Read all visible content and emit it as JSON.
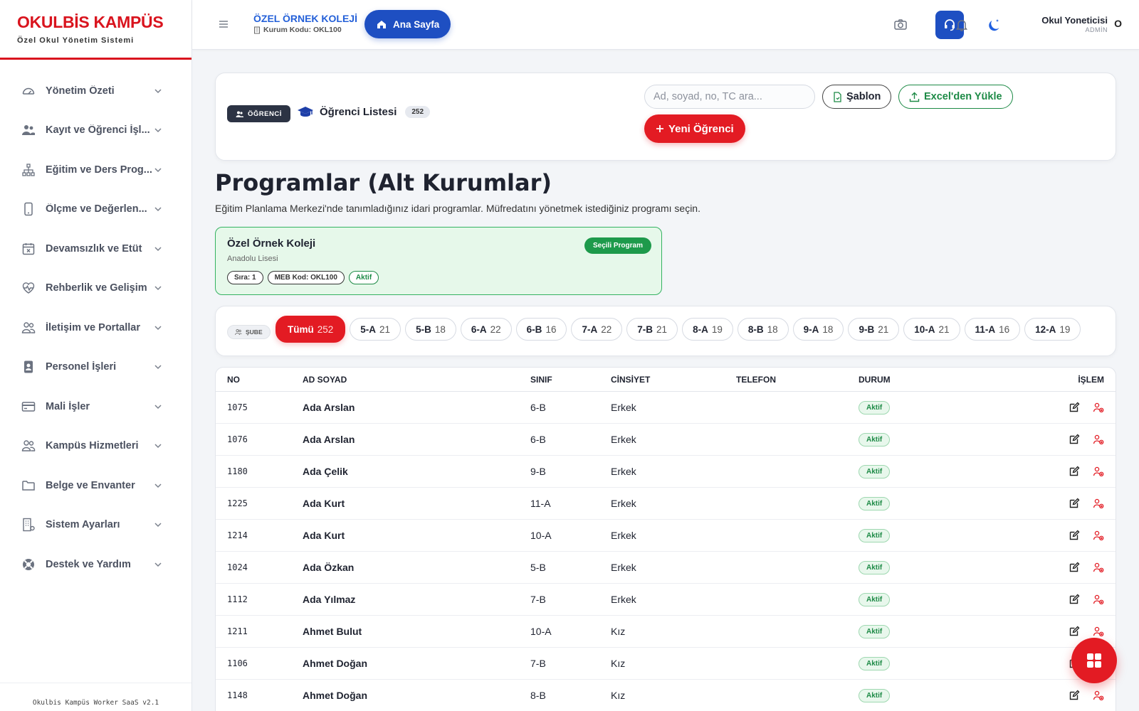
{
  "brand": {
    "title": "OKULBİS KAMPÜS",
    "subtitle": "Özel Okul Yönetim Sistemi"
  },
  "sidebar": {
    "items": [
      {
        "label": "Yönetim Özeti",
        "icon": "gauge-icon"
      },
      {
        "label": "Kayıt ve Öğrenci İşl...",
        "icon": "users-icon"
      },
      {
        "label": "Eğitim ve Ders Prog...",
        "icon": "sitemap-icon"
      },
      {
        "label": "Ölçme ve Değerlen...",
        "icon": "mobile-icon"
      },
      {
        "label": "Devamsızlık ve Etüt",
        "icon": "calendar-x-icon"
      },
      {
        "label": "Rehberlik ve Gelişim",
        "icon": "heart-pulse-icon"
      },
      {
        "label": "İletişim ve Portallar",
        "icon": "people-icon"
      },
      {
        "label": "Personel İşleri",
        "icon": "id-badge-icon"
      },
      {
        "label": "Mali İşler",
        "icon": "credit-card-icon"
      },
      {
        "label": "Kampüs Hizmetleri",
        "icon": "people-icon"
      },
      {
        "label": "Belge ve Envanter",
        "icon": "folder-icon"
      },
      {
        "label": "Sistem Ayarları",
        "icon": "building-gear-icon"
      },
      {
        "label": "Destek ve Yardım",
        "icon": "lifebuoy-icon"
      }
    ],
    "footer": "Okulbis Kampüs Worker SaaS v2.1"
  },
  "topbar": {
    "school_name": "ÖZEL ÖRNEK KOLEJİ",
    "school_code": "Kurum Kodu: OKL100",
    "home_label": "Ana Sayfa",
    "user_name": "Okul Yoneticisi",
    "user_role": "ADMİN",
    "user_initial": "O"
  },
  "header": {
    "chip": "ÖĞRENCİ",
    "list_title": "Öğrenci Listesi",
    "count": "252",
    "search_placeholder": "Ad, soyad, no, TC ara...",
    "template_label": "Şablon",
    "excel_label": "Excel'den Yükle",
    "new_label": "Yeni Öğrenci"
  },
  "page": {
    "title": "Programlar (Alt Kurumlar)",
    "description": "Eğitim Planlama Merkezi'nde tanımladığınız idari programlar. Müfredatını yönetmek istediğiniz programı seçin."
  },
  "program": {
    "name": "Özel Örnek Koleji",
    "type": "Anadolu Lisesi",
    "badge": "Seçili Program",
    "tags": [
      "Sıra: 1",
      "MEB Kod: OKL100",
      "Aktif"
    ]
  },
  "filters": {
    "label": "ŞUBE",
    "pills": [
      {
        "name": "Tümü",
        "count": "252"
      },
      {
        "name": "5-A",
        "count": "21"
      },
      {
        "name": "5-B",
        "count": "18"
      },
      {
        "name": "6-A",
        "count": "22"
      },
      {
        "name": "6-B",
        "count": "16"
      },
      {
        "name": "7-A",
        "count": "22"
      },
      {
        "name": "7-B",
        "count": "21"
      },
      {
        "name": "8-A",
        "count": "19"
      },
      {
        "name": "8-B",
        "count": "18"
      },
      {
        "name": "9-A",
        "count": "18"
      },
      {
        "name": "9-B",
        "count": "21"
      },
      {
        "name": "10-A",
        "count": "21"
      },
      {
        "name": "11-A",
        "count": "16"
      },
      {
        "name": "12-A",
        "count": "19"
      }
    ]
  },
  "table": {
    "headers": {
      "no": "NO",
      "name": "AD SOYAD",
      "class": "SINIF",
      "gender": "CİNSİYET",
      "phone": "TELEFON",
      "status": "DURUM",
      "action": "İŞLEM"
    },
    "rows": [
      {
        "no": "1075",
        "name": "Ada Arslan",
        "class": "6-B",
        "gender": "Erkek",
        "phone": "",
        "status": "Aktif"
      },
      {
        "no": "1076",
        "name": "Ada Arslan",
        "class": "6-B",
        "gender": "Erkek",
        "phone": "",
        "status": "Aktif"
      },
      {
        "no": "1180",
        "name": "Ada Çelik",
        "class": "9-B",
        "gender": "Erkek",
        "phone": "",
        "status": "Aktif"
      },
      {
        "no": "1225",
        "name": "Ada Kurt",
        "class": "11-A",
        "gender": "Erkek",
        "phone": "",
        "status": "Aktif"
      },
      {
        "no": "1214",
        "name": "Ada Kurt",
        "class": "10-A",
        "gender": "Erkek",
        "phone": "",
        "status": "Aktif"
      },
      {
        "no": "1024",
        "name": "Ada Özkan",
        "class": "5-B",
        "gender": "Erkek",
        "phone": "",
        "status": "Aktif"
      },
      {
        "no": "1112",
        "name": "Ada Yılmaz",
        "class": "7-B",
        "gender": "Erkek",
        "phone": "",
        "status": "Aktif"
      },
      {
        "no": "1211",
        "name": "Ahmet Bulut",
        "class": "10-A",
        "gender": "Kız",
        "phone": "",
        "status": "Aktif"
      },
      {
        "no": "1106",
        "name": "Ahmet Doğan",
        "class": "7-B",
        "gender": "Kız",
        "phone": "",
        "status": "Aktif"
      },
      {
        "no": "1148",
        "name": "Ahmet Doğan",
        "class": "8-B",
        "gender": "Kız",
        "phone": "",
        "status": "Aktif"
      }
    ]
  },
  "colors": {
    "brand_red": "#e31b23",
    "primary_blue": "#1e4fc2",
    "success_green": "#1d8a46"
  }
}
